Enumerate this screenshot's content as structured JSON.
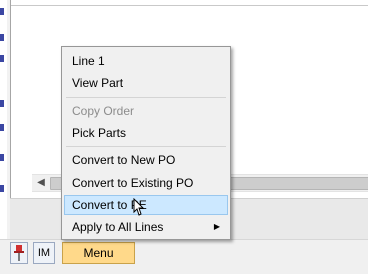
{
  "toolbar": {
    "im_label": "IM",
    "menu_label": "Menu"
  },
  "context_menu": {
    "items": [
      {
        "label": "Line 1",
        "enabled": true
      },
      {
        "label": "View Part",
        "enabled": true
      },
      {
        "label": "Copy Order",
        "enabled": false
      },
      {
        "label": "Pick Parts",
        "enabled": true
      },
      {
        "label": "Convert to New PO",
        "enabled": true
      },
      {
        "label": "Convert to Existing PO",
        "enabled": true
      },
      {
        "label": "Convert to PE",
        "enabled": true,
        "highlighted": true
      },
      {
        "label": "Apply to All Lines",
        "enabled": true,
        "has_submenu": true
      }
    ]
  },
  "colors": {
    "menu_button_bg": "#ffd98a",
    "highlight_bg": "#cce8ff",
    "disabled_text": "#8c8c8c"
  },
  "icons": {
    "pin": "pushpin-icon",
    "scroll_left": "scroll-left-arrow-icon",
    "submenu": "submenu-arrow-icon",
    "cursor": "mouse-pointer-icon"
  }
}
